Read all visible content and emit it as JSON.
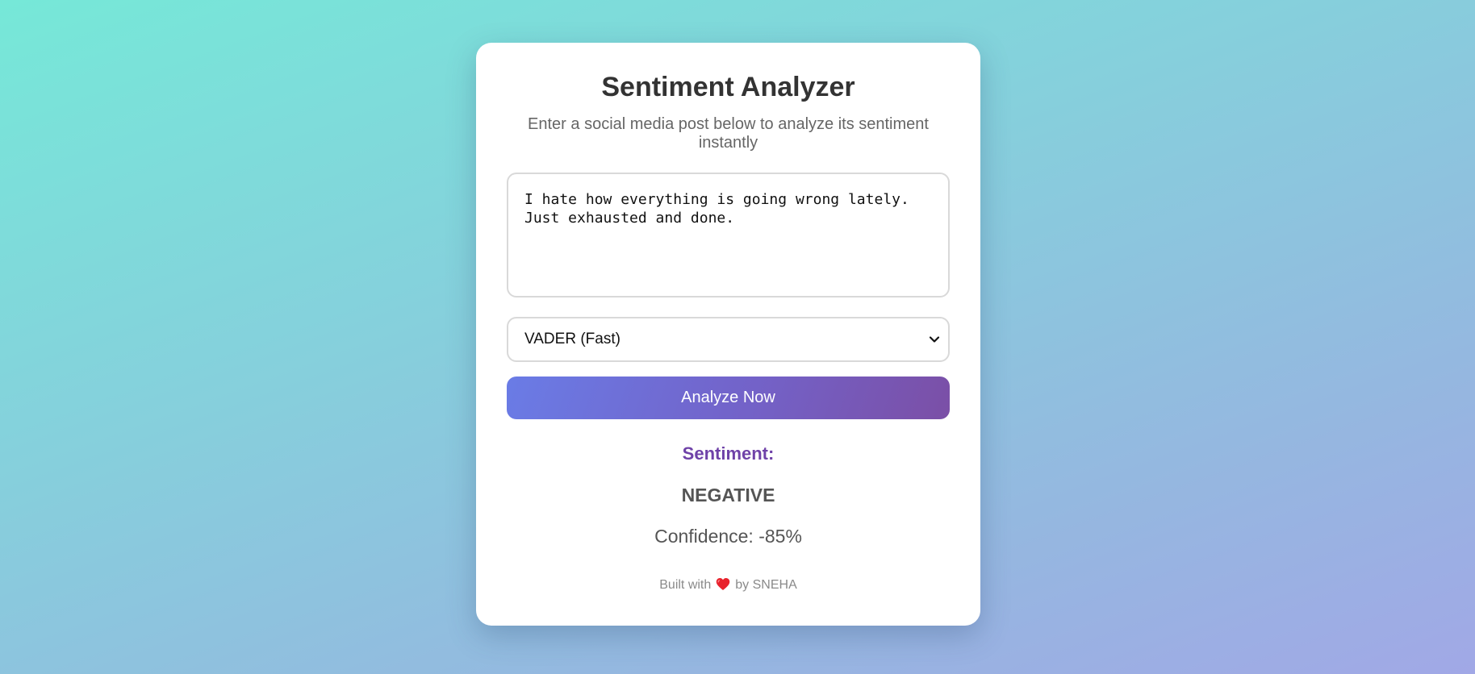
{
  "header": {
    "title": "Sentiment Analyzer",
    "subtitle": "Enter a social media post below to analyze its sentiment instantly"
  },
  "input": {
    "post_text": "I hate how everything is going wrong lately. Just exhausted and done."
  },
  "model_select": {
    "selected": "VADER (Fast)",
    "icon": "chevron-down-icon"
  },
  "action": {
    "analyze_label": "Analyze Now"
  },
  "result": {
    "label": "Sentiment:",
    "value": "NEGATIVE",
    "confidence": "Confidence: -85%"
  },
  "footer": {
    "prefix": "Built with",
    "icon": "heart-icon",
    "suffix": "by SNEHA"
  },
  "colors": {
    "accent": "#6f42a8",
    "button_start": "#6a7ce6",
    "button_end": "#7b4fa6",
    "heart": "#e8222c"
  }
}
